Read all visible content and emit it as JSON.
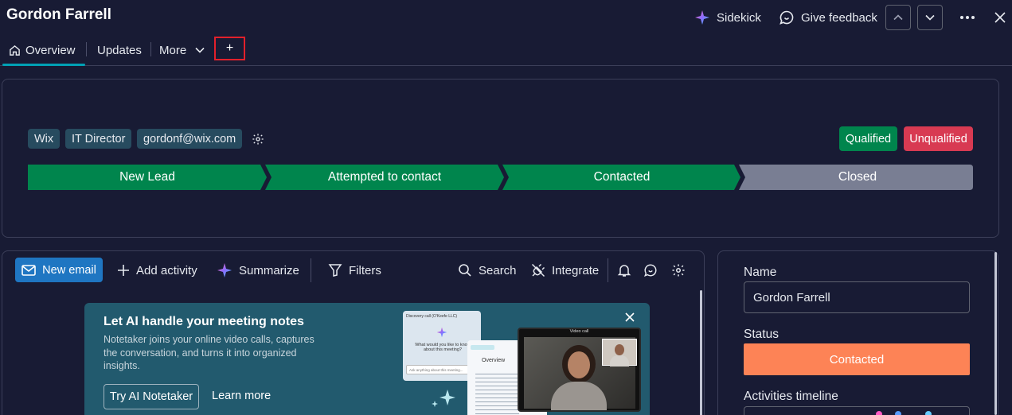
{
  "header": {
    "title": "Gordon Farrell",
    "sidekick_label": "Sidekick",
    "feedback_label": "Give feedback"
  },
  "tabs": {
    "overview": "Overview",
    "updates": "Updates",
    "more": "More",
    "add": "+"
  },
  "tags": [
    "Wix",
    "IT Director",
    "gordonf@wix.com"
  ],
  "qualification": {
    "qualified": "Qualified",
    "unqualified": "Unqualified",
    "qualified_color": "#00854d",
    "unqualified_color": "#d83a52"
  },
  "stages": [
    {
      "label": "New Lead",
      "color": "#00854d"
    },
    {
      "label": "Attempted to contact",
      "color": "#00854d"
    },
    {
      "label": "Contacted",
      "color": "#00854d"
    },
    {
      "label": "Closed",
      "color": "#797e93"
    }
  ],
  "toolbar": {
    "new_email": "New email",
    "add_activity": "Add activity",
    "summarize": "Summarize",
    "filters": "Filters",
    "search": "Search",
    "integrate": "Integrate"
  },
  "banner": {
    "title": "Let AI handle your meeting notes",
    "description": "Notetaker joins your online video calls, captures the conversation, and turns it into organized insights.",
    "try_button": "Try AI Notetaker",
    "learn_more": "Learn more",
    "mock_card_title": "Discovery call (O'Keefe LLC)",
    "mock_card_question": "What would you like to know about this meeting?",
    "mock_card_input": "Ask anything about this meeting...",
    "mock_doc_heading": "Overview",
    "mock_video_label": "Video call"
  },
  "details": {
    "name_label": "Name",
    "name_value": "Gordon Farrell",
    "status_label": "Status",
    "status_value": "Contacted",
    "status_color": "#fd8356",
    "timeline_label": "Activities timeline"
  }
}
